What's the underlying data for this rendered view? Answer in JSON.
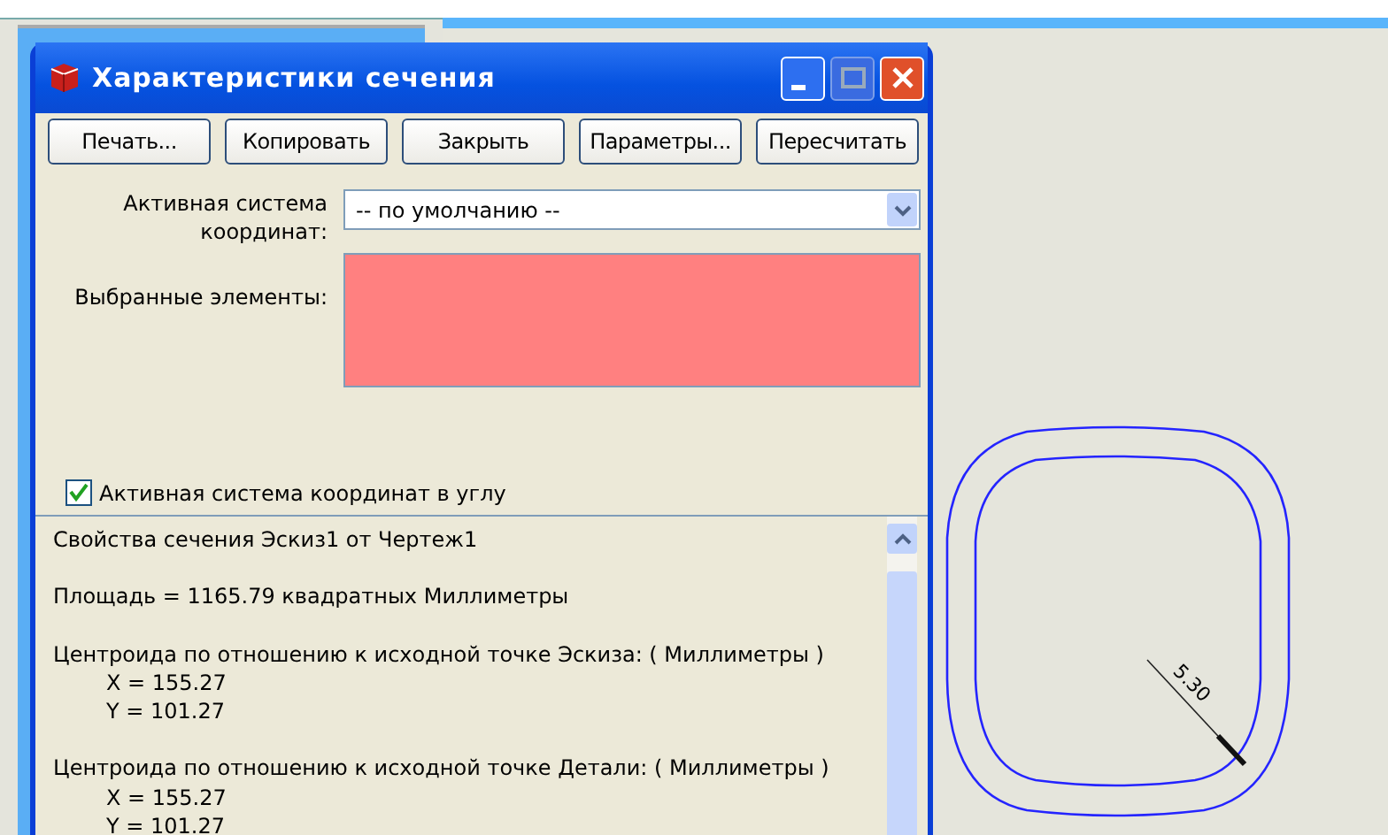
{
  "window": {
    "title": "Характеристики сечения"
  },
  "buttons": [
    "Печать...",
    "Копировать",
    "Закрыть",
    "Параметры...",
    "Пересчитать"
  ],
  "coordinate_system": {
    "label": "Активная система координат:",
    "value": "-- по умолчанию --"
  },
  "selected_elements": {
    "label": "Выбранные элементы:"
  },
  "corner_checkbox": {
    "label": "Активная система координат в углу",
    "checked": true
  },
  "results": [
    {
      "heading": "Свойства сечения Эскиз1 от Чертеж1"
    },
    {
      "heading": "Площадь = 1165.79 квадратных Миллиметры"
    },
    {
      "heading": "Центроида по отношению к исходной точке Эскиза: ( Миллиметры )",
      "values": [
        "X = 155.27",
        "Y = 101.27"
      ]
    },
    {
      "heading": "Центроида по отношению к исходной точке Детали: ( Миллиметры )",
      "values": [
        "X = 155.27",
        "Y = 101.27"
      ]
    }
  ],
  "sketch": {
    "dimension": "5.30"
  }
}
